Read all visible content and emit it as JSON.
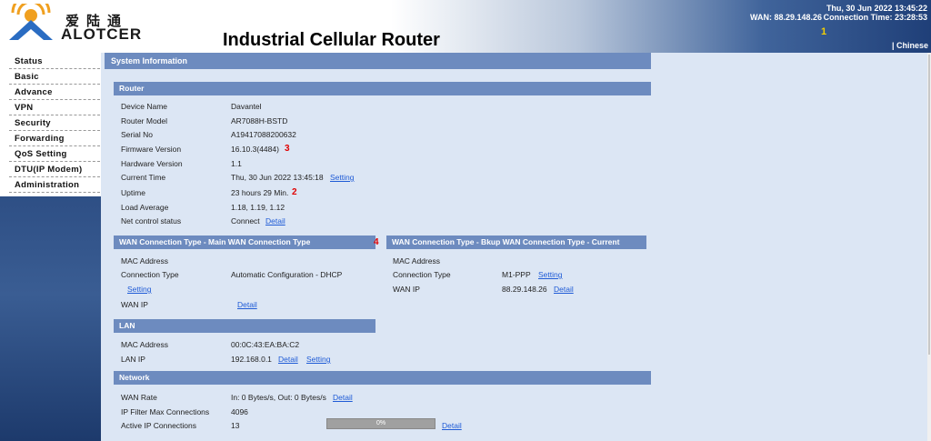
{
  "header": {
    "brand_cn": "爱陆通",
    "brand_en": "ALOTCER",
    "title": "Industrial Cellular Router",
    "date": "Thu, 30 Jun 2022 13:45:22",
    "wan": "WAN: 88.29.148.26",
    "connection_time": "Connection Time: 23:28:53",
    "marker": "1",
    "language_link": "| Chinese"
  },
  "sidebar": {
    "items": [
      {
        "label": "Status"
      },
      {
        "label": "Basic"
      },
      {
        "label": "Advance"
      },
      {
        "label": "VPN"
      },
      {
        "label": "Security"
      },
      {
        "label": "Forwarding"
      },
      {
        "label": "QoS Setting"
      },
      {
        "label": "DTU(IP Modem)"
      },
      {
        "label": "Administration"
      }
    ]
  },
  "page": {
    "section_title": "System Information"
  },
  "router": {
    "title": "Router",
    "rows": [
      {
        "label": "Device Name",
        "value": "Davantel"
      },
      {
        "label": "Router Model",
        "value": "AR7088H-BSTD"
      },
      {
        "label": "Serial No",
        "value": "A19417088200632"
      },
      {
        "label": "Firmware Version",
        "value": "16.10.3(4484)",
        "marker": "3"
      },
      {
        "label": "Hardware Version",
        "value": "1.1"
      },
      {
        "label": "Current Time",
        "value": "Thu, 30 Jun 2022 13:45:18",
        "link": "Setting"
      },
      {
        "label": "Uptime",
        "value": "23 hours 29 Min.",
        "marker": "2"
      },
      {
        "label": "Load Average",
        "value": "1.18, 1.19, 1.12"
      },
      {
        "label": "Net control status",
        "value": "Connect",
        "link": "Detail"
      }
    ]
  },
  "wan_main": {
    "title": "WAN Connection Type - Main WAN Connection Type",
    "marker": "4",
    "mac_label": "MAC Address",
    "conn_label": "Connection Type",
    "conn_value": "Automatic Configuration - DHCP",
    "conn_link": "Setting",
    "ip_label": "WAN IP",
    "ip_link": "Detail"
  },
  "wan_backup": {
    "title": "WAN Connection Type - Bkup WAN Connection Type - Current",
    "mac_label": "MAC Address",
    "conn_label": "Connection Type",
    "conn_value": "M1-PPP",
    "conn_link": "Setting",
    "ip_label": "WAN IP",
    "ip_value": "88.29.148.26",
    "ip_link": "Detail"
  },
  "lan": {
    "title": "LAN",
    "mac_label": "MAC Address",
    "mac_value": "00:0C:43:EA:BA:C2",
    "ip_label": "LAN IP",
    "ip_value": "192.168.0.1",
    "detail_link": "Detail",
    "setting_link": "Setting"
  },
  "network": {
    "title": "Network",
    "rate_label": "WAN Rate",
    "rate_value": "In: 0 Bytes/s, Out: 0 Bytes/s",
    "rate_link": "Detail",
    "filter_label": "IP Filter Max Connections",
    "filter_value": "4096",
    "active_label": "Active IP Connections",
    "active_value": "13",
    "progress_text": "0%",
    "progress_fraction": 0,
    "active_link": "Detail"
  },
  "colors": {
    "section_bg": "#6d8bbf",
    "content_bg": "#dce6f4",
    "link": "#1f5bd6",
    "marker_red": "#e00000",
    "marker_yellow": "#f5d000"
  }
}
